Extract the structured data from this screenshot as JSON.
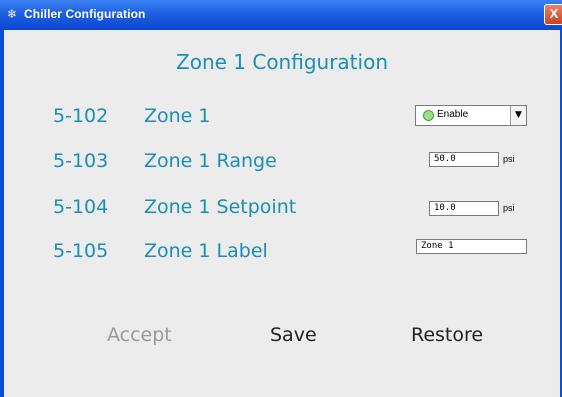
{
  "window": {
    "title": "Chiller Configuration",
    "close_label": "X"
  },
  "panel": {
    "title": "Zone 1 Configuration",
    "rows": [
      {
        "code": "5-102",
        "label": "Zone 1"
      },
      {
        "code": "5-103",
        "label": "Zone 1 Range"
      },
      {
        "code": "5-104",
        "label": "Zone 1 Setpoint"
      },
      {
        "code": "5-105",
        "label": "Zone 1 Label"
      }
    ],
    "zone_select": {
      "value": "Enable",
      "indicator_color": "#9ee08a"
    },
    "range": {
      "value": "50.0",
      "unit": "psi"
    },
    "setpoint": {
      "value": "10.0",
      "unit": "psi"
    },
    "label_field": {
      "value": "Zone 1"
    }
  },
  "buttons": {
    "accept": "Accept",
    "save": "Save",
    "restore": "Restore"
  },
  "colors": {
    "accent_text": "#1a8fb5",
    "titlebar": "#0b46d2",
    "disabled_text": "#9a9a9a"
  }
}
